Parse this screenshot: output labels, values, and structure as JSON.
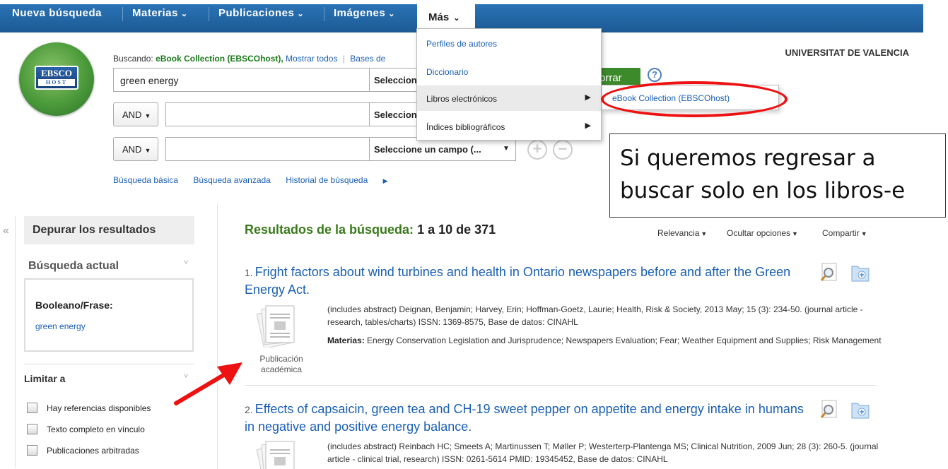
{
  "nav": {
    "items": [
      {
        "label": "Nueva búsqueda",
        "caret": ""
      },
      {
        "label": "Materias",
        "caret": "⌄"
      },
      {
        "label": "Publicaciones",
        "caret": "⌄"
      },
      {
        "label": "Imágenes",
        "caret": "⌄"
      }
    ],
    "mas_label": "Más",
    "mas_caret": "⌄"
  },
  "search": {
    "scope_prefix": "Buscando:",
    "scope_db": "eBook Collection (EBSCOhost),",
    "scope_show_all": "Mostrar todos",
    "scope_sep": "|",
    "scope_more": "Bases de",
    "query": "green energy",
    "field_select_1": "Seleccion",
    "field_select_2": "Seleccion",
    "field_select_3": "Seleccione un campo (...",
    "bool_1": "AND",
    "bool_2": "AND",
    "search_btn_partial": "orrar",
    "help": "?",
    "links": [
      "Búsqueda básica",
      "Búsqueda avanzada",
      "Historial de búsqueda"
    ],
    "history_arrow": "▶"
  },
  "logo": {
    "line1": "EBSCO",
    "line2": "HOST"
  },
  "institution": "UNIVERSITAT DE VALENCIA",
  "dropdown": {
    "items": [
      "Perfiles de autores",
      "Diccionario",
      "Libros electrónicos",
      "Índices bibliográficos"
    ],
    "arrow": "▶",
    "submenu": "eBook Collection (EBSCOhost)"
  },
  "callout": {
    "line1": "Si queremos regresar a",
    "line2": "buscar solo en los libros-e"
  },
  "left": {
    "collapse": "«",
    "refine": "Depurar los resultados",
    "current_search": "Búsqueda actual",
    "bool_label": "Booleano/Frase:",
    "bool_value": "green energy",
    "limit": "Limitar a",
    "caret": "˅",
    "checkboxes": [
      "Hay referencias disponibles",
      "Texto completo en vínculo",
      "Publicaciones arbitradas"
    ]
  },
  "results": {
    "heading": "Resultados de la búsqueda:",
    "count": "1 a 10 de 371",
    "options": [
      "Relevancia",
      "Ocultar opciones",
      "Compartir"
    ],
    "items": [
      {
        "num": "1.",
        "title": "Fright factors about wind turbines and health in Ontario newspapers before and after the Green Energy Act.",
        "meta": "(includes abstract) Deignan, Benjamin; Harvey, Erin; Hoffman-Goetz, Laurie; Health, Risk & Society, 2013 May; 15 (3): 234-50. (journal article - research, tables/charts) ISSN: 1369-8575, Base de datos: CINAHL",
        "subjects_label": "Materias:",
        "subjects": "Energy Conservation Legislation and Jurisprudence; Newspapers Evaluation; Fear; Weather Equipment and Supplies; Risk Management",
        "pub_type_1": "Publicación",
        "pub_type_2": "académica"
      },
      {
        "num": "2.",
        "title": "Effects of capsaicin, green tea and CH-19 sweet pepper on appetite and energy intake in humans in negative and positive energy balance.",
        "meta": "(includes abstract) Reinbach HC; Smeets A; Martinussen T; Møller P; Westerterp-Plantenga MS; Clinical Nutrition, 2009 Jun; 28 (3): 260-5. (journal article - clinical trial, research) ISSN: 0261-5614 PMID: 19345452, Base de datos: CINAHL"
      }
    ]
  }
}
